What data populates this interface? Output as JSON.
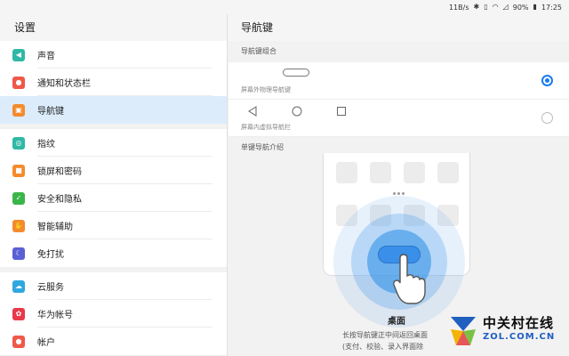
{
  "status_bar": {
    "speed": "11B/s",
    "battery": "90%",
    "time": "17:25"
  },
  "left": {
    "title": "设置",
    "groups": [
      [
        {
          "label": "声音",
          "icon": "speaker-icon",
          "color": "#2fb8a6"
        },
        {
          "label": "通知和状态栏",
          "icon": "bell-icon",
          "color": "#f0584a"
        },
        {
          "label": "导航键",
          "icon": "navkey-icon",
          "color": "#f58b2c",
          "active": true
        }
      ],
      [
        {
          "label": "指纹",
          "icon": "fingerprint-icon",
          "color": "#2fb8a6"
        },
        {
          "label": "锁屏和密码",
          "icon": "lock-icon",
          "color": "#f58b2c"
        },
        {
          "label": "安全和隐私",
          "icon": "shield-icon",
          "color": "#3bb54a"
        },
        {
          "label": "智能辅助",
          "icon": "hand-icon",
          "color": "#f58b2c"
        },
        {
          "label": "免打扰",
          "icon": "moon-icon",
          "color": "#5b5fd6"
        }
      ],
      [
        {
          "label": "云服务",
          "icon": "cloud-icon",
          "color": "#2fa8e0"
        },
        {
          "label": "华为帐号",
          "icon": "huawei-icon",
          "color": "#e8384a"
        },
        {
          "label": "帐户",
          "icon": "account-icon",
          "color": "#f0584a"
        }
      ]
    ]
  },
  "right": {
    "title": "导航键",
    "section1": "导航键组合",
    "option1": {
      "caption": "屏幕外物理导航键",
      "checked": true
    },
    "option2": {
      "caption": "屏幕内虚拟导航栏",
      "checked": false
    },
    "section2": "单键导航介绍",
    "illustration": {
      "label": "桌面",
      "desc_line1": "长按导航键正中间返回桌面",
      "desc_line2": "(支付、校验、录入界面除"
    }
  },
  "watermark": {
    "cn": "中关村在线",
    "en": "ZOL.COM.CN"
  },
  "colors": {
    "accent": "#1a7bf0",
    "active_bg": "#dcecfb"
  }
}
